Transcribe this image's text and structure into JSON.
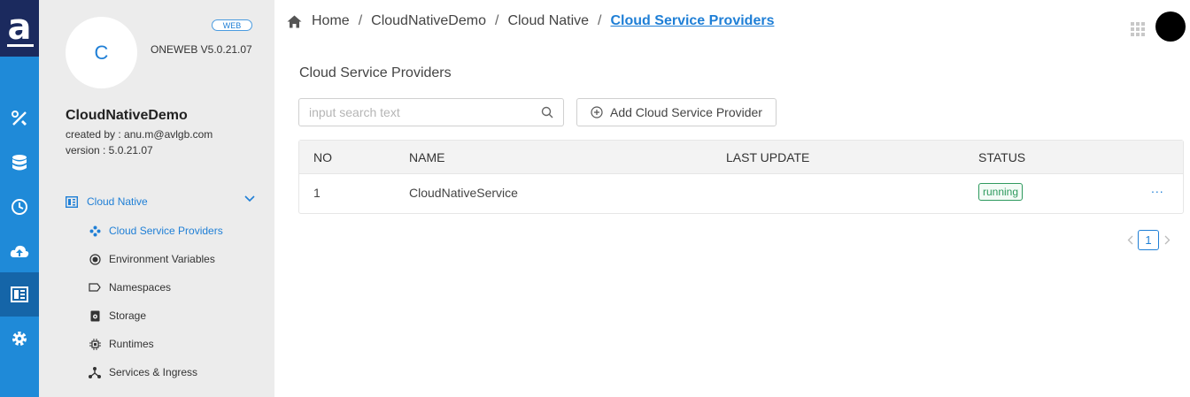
{
  "panel": {
    "avatar_letter": "C",
    "badge": "WEB",
    "app_version": "ONEWEB V5.0.21.07",
    "project_name": "CloudNativeDemo",
    "created_by": "created by : anu.m@avlgb.com",
    "version": "version : 5.0.21.07",
    "group_label": "Cloud Native",
    "items": [
      {
        "label": "Cloud Service Providers",
        "icon": "providers-icon"
      },
      {
        "label": "Environment Variables",
        "icon": "env-variables-icon"
      },
      {
        "label": "Namespaces",
        "icon": "tag-icon"
      },
      {
        "label": "Storage",
        "icon": "storage-icon"
      },
      {
        "label": "Runtimes",
        "icon": "chip-icon"
      },
      {
        "label": "Services & Ingress",
        "icon": "network-icon"
      }
    ]
  },
  "breadcrumb": {
    "items": [
      "Home",
      "CloudNativeDemo",
      "Cloud Native"
    ],
    "current": "Cloud Service Providers"
  },
  "main": {
    "title": "Cloud Service Providers",
    "search_placeholder": "input search text",
    "add_button": "Add Cloud Service Provider",
    "columns": [
      "NO",
      "NAME",
      "LAST UPDATE",
      "STATUS"
    ],
    "rows": [
      {
        "no": "1",
        "name": "CloudNativeService",
        "last_update": "",
        "status": "running",
        "more": "..."
      }
    ],
    "page": "1"
  },
  "colors": {
    "rail": "#1f8ad8",
    "rail_active": "#1565a8",
    "logo": "#1b2a5e",
    "accent": "#1f7fd6",
    "running": "#2e9a5e"
  }
}
